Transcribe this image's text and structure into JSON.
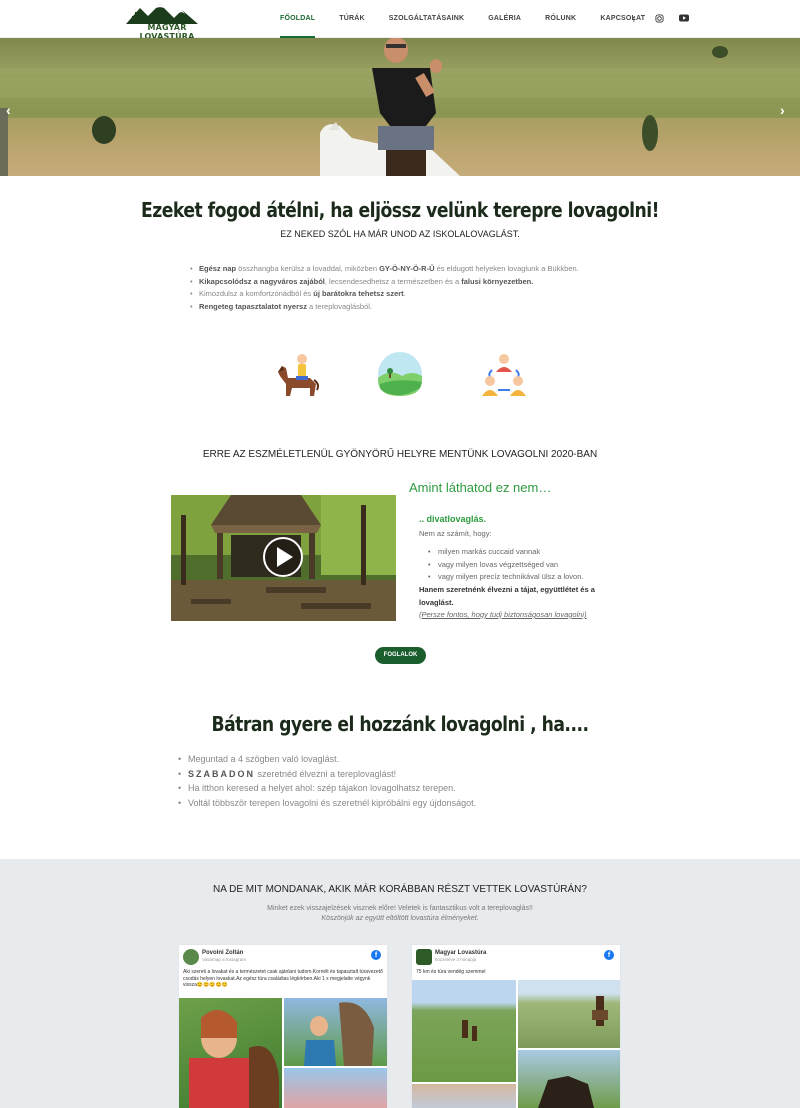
{
  "nav": {
    "logo_text": "MAGYAR LOVASTÚRA",
    "items": [
      "FŐOLDAL",
      "TÚRÁK",
      "SZOLGÁLTATÁSAINK",
      "GALÉRIA",
      "RÓLUNK",
      "KAPCSOLAT"
    ],
    "social": [
      "facebook-icon",
      "instagram-icon",
      "youtube-icon"
    ]
  },
  "hero": {
    "prev": "‹",
    "next": "›"
  },
  "section1": {
    "title": "Ezeket fogod átélni, ha eljössz velünk terepre lovagolni!",
    "subtitle": "EZ NEKED SZÓL HA MÁR UNOD AZ ISKOLALOVAGLÁST.",
    "bullets": [
      {
        "b1": "Egész nap",
        "t1": " összhangba kerülsz a lovaddal, miközben ",
        "b2": "GY-Ö-NY-Ö-R-Ű",
        "t2": " és eldugott helyeken lovaglunk a Bükkben."
      },
      {
        "b1": "Kikapcsolódsz a nagyváros zajából",
        "t1": ", lecsendesedhetsz a természetben és a ",
        "b2": "falusi környezetben.",
        "t2": ""
      },
      {
        "b1": "",
        "t1": "Kimozdulsz a komfortzónádból és ",
        "b2": "új barátokra tehetsz szert",
        "t2": "."
      },
      {
        "b1": "Rengeteg tapasztalatot nyersz",
        "t1": " a tereplovaglásból.",
        "b2": "",
        "t2": ""
      }
    ]
  },
  "section2": {
    "title": "ERRE AZ ESZMÉLETLENÜL GYÖNYÖRŰ HELYRE MENTÜNK LOVAGOLNI 2020-BAN",
    "right_title": "Amint láthatod ez nem…",
    "right_sub": ".. divatlovaglás.",
    "right_p": "Nem az számít, hogy:",
    "bullets": [
      "milyen markás cuccaid vannak",
      "vagy milyen lovas végzettséged van",
      "vagy milyen precíz technikával ülsz a lovon."
    ],
    "bold": "Hanem szeretnénk élvezni a tájat, együttlétet és a lovaglást.",
    "link": "(Persze fontos, hogy tudj biztonságosan lovagolni)",
    "button": "FOGLALOK"
  },
  "section3": {
    "title": "Bátran gyere el hozzánk lovagolni , ha....",
    "b1": "Meguntad a 4 szögben való lovaglást.",
    "b2_bold": "SZABADON",
    "b2": " szeretnéd élvezni a tereplovaglást!",
    "b3": "Ha itthon keresed a helyet ahol: szép tájakon lovagolhatsz terepen.",
    "b4": "Voltál többször terepen lovagolni és szeretnél kipróbálni egy újdonságot."
  },
  "testimonials": {
    "title": "NA DE MIT MONDANAK, AKIK MÁR KORÁBBAN RÉSZT VETTEK LOVASTÚRÁN?",
    "sub": "Minket ezek visszajelzések visznek előre! Veletek is fantasztikus volt a tereplovaglás!!",
    "sub2": "Köszönjük az együtt eltöltött lovastúra élményeket.",
    "cards": [
      {
        "name": "Povolni Zoltán",
        "meta": "Vasárnap a Instagram",
        "text": "Aki szereti a lovakat és a természetet csak ajánlani tudom.Kornélt és tapasztalt túravezető csodás helyen lovaskat.Az egész túra családias légkörben.Aki 1 x megjelatte végynk vissza😊😊😊😊😊"
      },
      {
        "name": "Magyar Lovastúra",
        "meta": "közzétéve 2 hónapja",
        "text": "75 km és túra vendég szemmel"
      }
    ]
  }
}
